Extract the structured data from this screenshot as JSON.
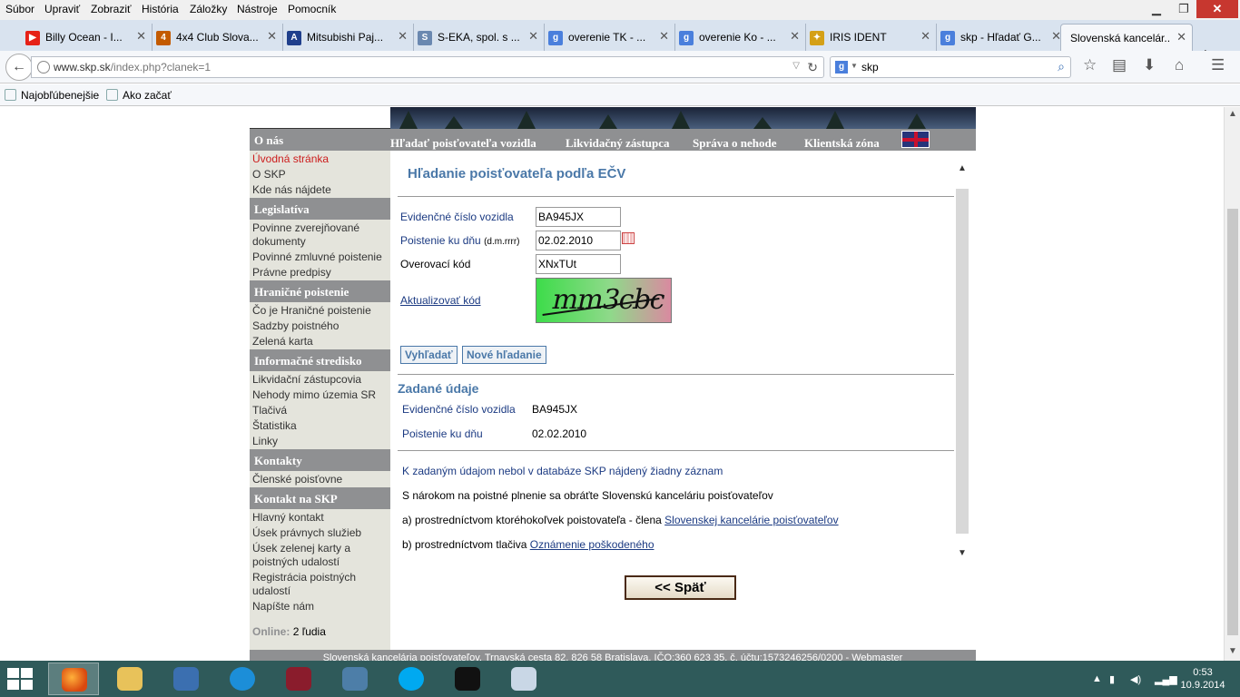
{
  "menubar": {
    "items": [
      "Súbor",
      "Upraviť",
      "Zobraziť",
      "História",
      "Záložky",
      "Nástroje",
      "Pomocník"
    ]
  },
  "tabs": [
    {
      "title": "Billy Ocean - I...",
      "icon": "youtube-icon",
      "color": "#e62117"
    },
    {
      "title": "4x4 Club Slova...",
      "icon": "club-icon",
      "color": "#c35a00"
    },
    {
      "title": "Mitsubishi Paj...",
      "icon": "letter-m-icon",
      "color": "#1f3f8c"
    },
    {
      "title": "S-EKA, spol. s ...",
      "icon": "seka-icon",
      "color": "#6a88b0"
    },
    {
      "title": "overenie TK - ...",
      "icon": "google-icon",
      "color": "#4a7fdc"
    },
    {
      "title": "overenie Ko - ...",
      "icon": "google-icon",
      "color": "#4a7fdc"
    },
    {
      "title": "IRIS IDENT",
      "icon": "iris-icon",
      "color": "#d4a017"
    },
    {
      "title": "skp - Hľadať G...",
      "icon": "google-icon",
      "color": "#4a7fdc"
    },
    {
      "title": "Slovenská kancelár...",
      "icon": "",
      "color": ""
    }
  ],
  "navbar": {
    "url_host": "www.skp.sk",
    "url_path": "/index.php?clanek=1",
    "search_value": "skp"
  },
  "bookmarks": [
    "Najobľúbenejšie",
    "Ako začať"
  ],
  "site": {
    "topnav": [
      "Hľadať poisťovateľa vozidla",
      "Likvidačný zástupca",
      "Správa o nehode",
      "Klientská zóna"
    ],
    "sidebar": {
      "sections": [
        {
          "title": "O nás",
          "links": [
            "Úvodná stránka",
            "O SKP",
            "Kde nás nájdete"
          ]
        },
        {
          "title": "Legislatíva",
          "links": [
            "Povinne zverejňované dokumenty",
            "Povinné zmluvné poistenie",
            "Právne predpisy"
          ]
        },
        {
          "title": "Hraničné poistenie",
          "links": [
            "Čo je Hraničné poistenie",
            "Sadzby poistného",
            "Zelená karta"
          ]
        },
        {
          "title": "Informačné stredisko",
          "links": [
            "Likvidační zástupcovia",
            "Nehody mimo územia SR",
            "Tlačivá",
            "Štatistika",
            "Linky"
          ]
        },
        {
          "title": "Kontakty",
          "links": [
            "Členské poisťovne"
          ]
        },
        {
          "title": "Kontakt na SKP",
          "links": [
            "Hlavný kontakt",
            "Úsek právnych služieb",
            "Úsek zelenej karty a poistných udalostí",
            "Registrácia poistných udalostí",
            "Napíšte nám"
          ]
        }
      ],
      "online_label": "Online:",
      "online_value": "2 ľudia"
    },
    "main": {
      "title": "Hľadanie poisťovateľa podľa EČV",
      "form": {
        "plate_label": "Evidenčné číslo vozidla",
        "plate_value": "BA945JX",
        "date_label": "Poistenie ku dňu",
        "date_hint": "(d.m.rrrr)",
        "date_value": "02.02.2010",
        "code_label": "Overovací kód",
        "code_value": "XNxTUt",
        "refresh_link": "Aktualizovať kód",
        "captcha_text": "mm3cbc",
        "search_button": "Vyhľadať",
        "new_search_button": "Nové hľadanie"
      },
      "entered": {
        "title": "Zadané údaje",
        "plate_label": "Evidenčné číslo vozidla",
        "plate_value": "BA945JX",
        "date_label": "Poistenie ku dňu",
        "date_value": "02.02.2010"
      },
      "result": {
        "not_found": "K zadaným údajom nebol v databáze SKP nájdený žiadny záznam",
        "claim": "S nárokom na poistné plnenie sa obráťte Slovenskú kanceláriu poisťovateľov",
        "option_a": "a) prostredníctvom ktoréhokoľvek poistovateľa - člena",
        "option_a_link": "Slovenskej kancelárie poisťovateľov",
        "option_b": "b) prostredníctvom tlačiva",
        "option_b_link": "Oznámenie poškodeného"
      },
      "back_button": "<<  Späť"
    },
    "footer": "Slovenská kancelária poisťovateľov, Trnavská cesta 82, 826 58 Bratislava, IČO:360 623 35, č. účtu:1573246256/0200 - Webmaster"
  },
  "taskbar": {
    "time": "0:53",
    "date": "10.9.2014"
  }
}
